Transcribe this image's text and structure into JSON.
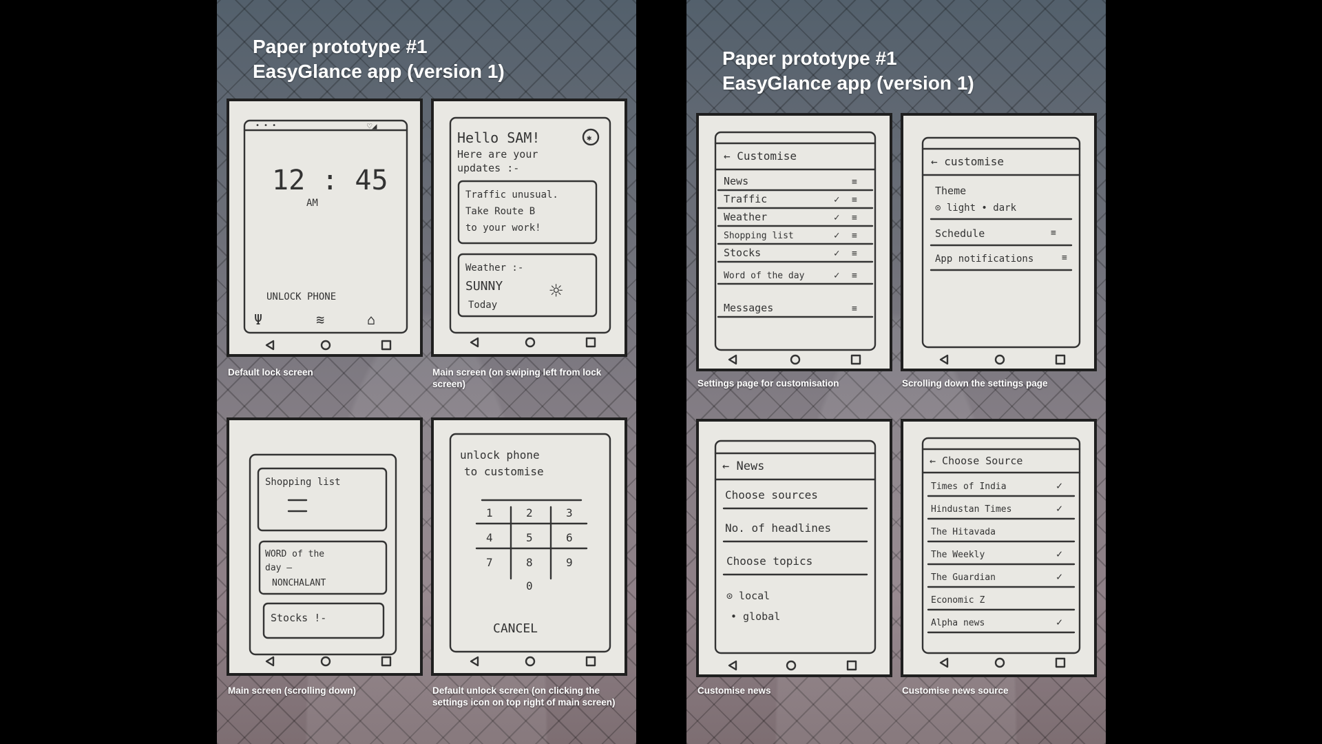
{
  "left_panel": {
    "title_line1": "Paper prototype #1",
    "title_line2": "EasyGlance app (version 1)",
    "screens": [
      {
        "caption": "Default lock screen",
        "sketch": {
          "time": "12 : 45",
          "ampm": "AM",
          "unlock": "UNLOCK  PHONE"
        }
      },
      {
        "caption": "Main screen (on swiping left from lock screen)",
        "sketch": {
          "greeting": "Hello SAM!",
          "sub1": "Here are your",
          "sub2": "updates :-",
          "traffic": [
            "Traffic unusual.",
            "Take Route B",
            "to your work!"
          ],
          "weather": [
            "Weather :-",
            "SUNNY",
            "Today"
          ]
        }
      },
      {
        "caption": "Main screen (scrolling down)",
        "sketch": {
          "shopping": "Shopping list",
          "word": [
            "WORD of the",
            "day —",
            "NONCHALANT"
          ],
          "stocks": "Stocks !-"
        }
      },
      {
        "caption": "Default unlock screen (on clicking the settings icon on top right of main screen)",
        "sketch": {
          "line1": "unlock phone",
          "line2": "to customise",
          "keys": [
            "1",
            "2",
            "3",
            "4",
            "5",
            "6",
            "7",
            "8",
            "9",
            "0"
          ],
          "cancel": "CANCEL"
        }
      }
    ]
  },
  "right_panel": {
    "title_line1": "Paper prototype #1",
    "title_line2": "EasyGlance app (version 1)",
    "screens": [
      {
        "caption": "Settings page for customisation",
        "sketch": {
          "header": "← Customise",
          "items": [
            "News",
            "Traffic",
            "Weather",
            "Shopping list",
            "Stocks",
            "Word of the day",
            "Messages"
          ]
        }
      },
      {
        "caption": "Scrolling down the settings page",
        "sketch": {
          "header": "← customise",
          "theme": "Theme",
          "theme_options": "⊙ light  • dark",
          "items": [
            "Schedule",
            "App notifications"
          ]
        }
      },
      {
        "caption": "Customise news",
        "sketch": {
          "header": "← News",
          "items": [
            "Choose sources",
            "No. of headlines",
            "Choose topics"
          ],
          "radio": [
            "⊙ local",
            "• global"
          ]
        }
      },
      {
        "caption": "Customise news source",
        "sketch": {
          "header": "← Choose Source",
          "items": [
            "Times of India",
            "Hindustan Times",
            "The Hitavada",
            "The Weekly",
            "The Guardian",
            "Economic Z",
            "Alpha news"
          ]
        }
      }
    ]
  },
  "colors": {
    "background": "#000000",
    "paper": "#e9e8e3",
    "ink": "#333333",
    "caption": "#ffffff"
  }
}
